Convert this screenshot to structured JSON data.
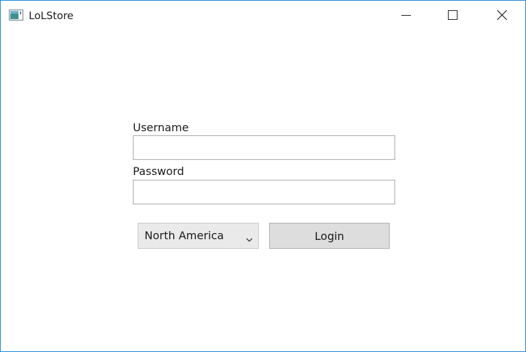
{
  "window": {
    "title": "LoLStore",
    "border_color": "#1883d7",
    "icon": "app-window-icon",
    "controls": {
      "minimize": "minimize-icon",
      "maximize": "maximize-icon",
      "close": "close-icon"
    }
  },
  "form": {
    "username_label": "Username",
    "username_value": "",
    "password_label": "Password",
    "password_value": "",
    "region": {
      "selected": "North America",
      "icon": "chevron-down-icon"
    },
    "login_label": "Login"
  }
}
